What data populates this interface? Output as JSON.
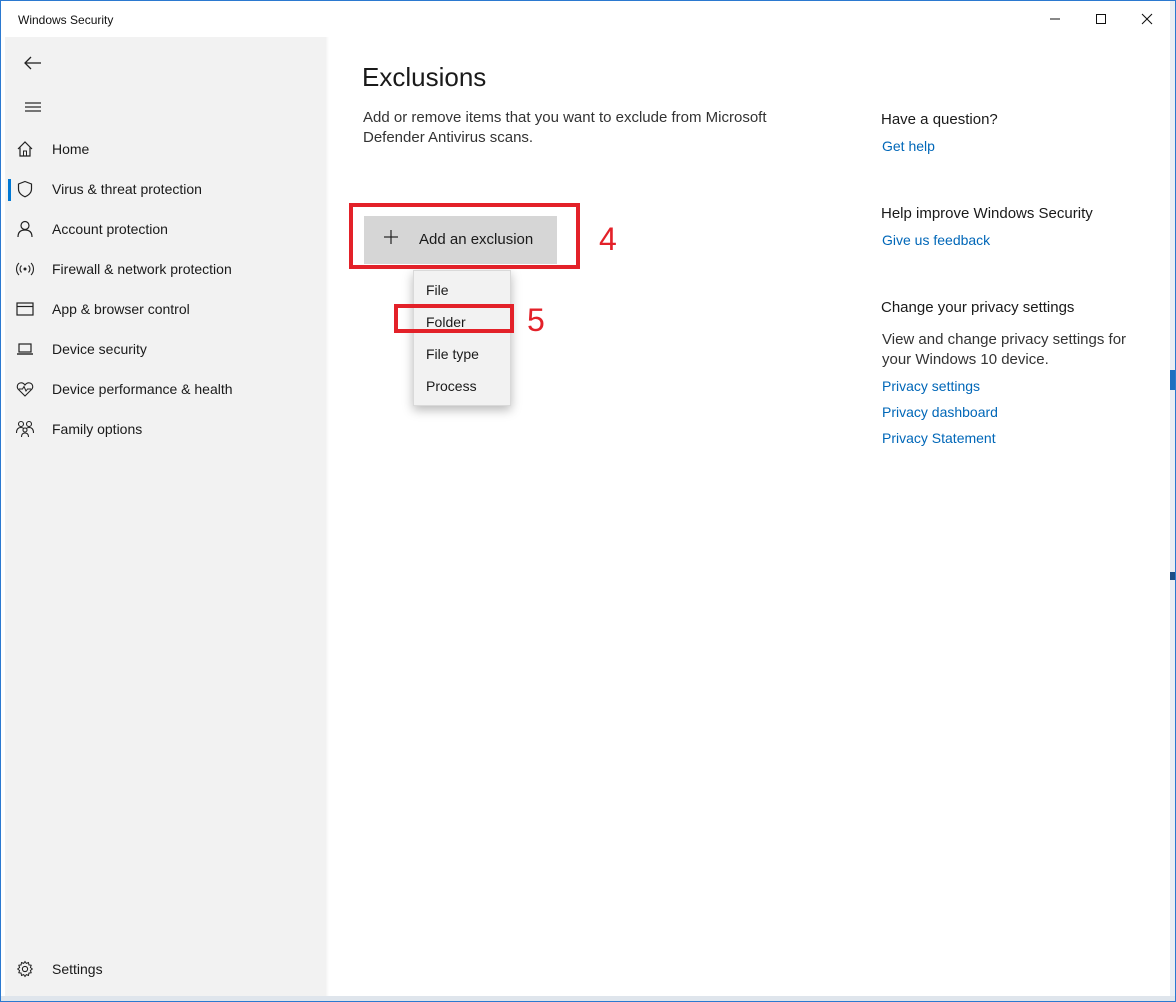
{
  "window": {
    "title": "Windows Security",
    "controls": [
      "minimize-icon",
      "maximize-icon",
      "close-icon"
    ]
  },
  "sidebar": {
    "back_icon": "back-arrow-icon",
    "menu_icon": "hamburger-menu-icon",
    "items": [
      {
        "label": "Home",
        "icon": "home-icon",
        "selected": false
      },
      {
        "label": "Virus & threat protection",
        "icon": "shield-icon",
        "selected": true
      },
      {
        "label": "Account protection",
        "icon": "person-icon",
        "selected": false
      },
      {
        "label": "Firewall & network protection",
        "icon": "wireless-icon",
        "selected": false
      },
      {
        "label": "App & browser control",
        "icon": "browser-window-icon",
        "selected": false
      },
      {
        "label": "Device security",
        "icon": "laptop-icon",
        "selected": false
      },
      {
        "label": "Device performance & health",
        "icon": "heart-pulse-icon",
        "selected": false
      },
      {
        "label": "Family options",
        "icon": "family-icon",
        "selected": false
      }
    ],
    "settings_label": "Settings",
    "accent_color": "#0078d4"
  },
  "main": {
    "title": "Exclusions",
    "description": "Add or remove items that you want to exclude from Microsoft Defender Antivirus scans.",
    "add_button_label": "Add an exclusion",
    "dropdown_options": [
      "File",
      "Folder",
      "File type",
      "Process"
    ]
  },
  "annotations": {
    "color": "#e32129",
    "step_add_button": "4",
    "step_folder_option": "5"
  },
  "help": {
    "question_heading": "Have a question?",
    "get_help": "Get help",
    "improve_heading": "Help improve Windows Security",
    "feedback": "Give us feedback",
    "privacy_heading": "Change your privacy settings",
    "privacy_text": "View and change privacy settings for your Windows 10 device.",
    "privacy_links": [
      "Privacy settings",
      "Privacy dashboard",
      "Privacy Statement"
    ],
    "link_color": "#0067b8"
  }
}
